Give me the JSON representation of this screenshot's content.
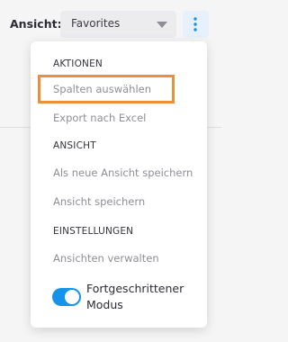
{
  "toolbar": {
    "view_label": "Ansicht:",
    "view_select_value": "Favorites"
  },
  "menu": {
    "sections": [
      {
        "header": "AKTIONEN",
        "items": [
          "Spalten auswählen",
          "Export nach Excel"
        ]
      },
      {
        "header": "ANSICHT",
        "items": [
          "Als neue Ansicht speichern",
          "Ansicht speichern"
        ]
      },
      {
        "header": "EINSTELLUNGEN",
        "items": [
          "Ansichten verwalten"
        ]
      }
    ],
    "toggle": {
      "label": "Fortgeschrittener Modus",
      "on": true
    }
  },
  "colors": {
    "accent": "#1593e8",
    "highlight": "#e8913a"
  },
  "icons": {
    "more": "more-vertical-icon",
    "dropdown": "chevron-down-icon"
  }
}
